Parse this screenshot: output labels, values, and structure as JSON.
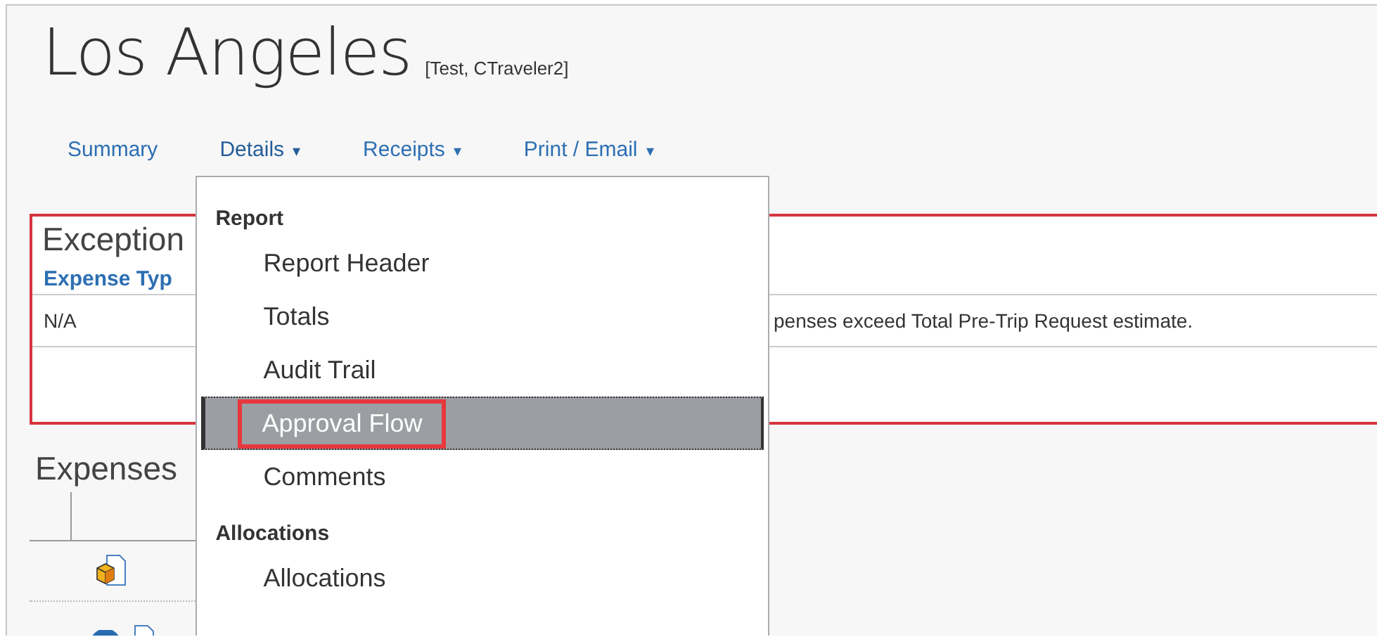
{
  "title": "Los Angeles",
  "subtitle": "[Test, CTraveler2]",
  "tabs": [
    {
      "label": "Summary",
      "expanded": false
    },
    {
      "label": "Details",
      "caret": "▾",
      "expanded": true,
      "menu": [
        {
          "heading": "Report",
          "items": [
            {
              "label": "Report Header",
              "selected": false
            },
            {
              "label": "Totals",
              "selected": false
            },
            {
              "label": "Audit Trail",
              "selected": false
            },
            {
              "label": "Approval Flow",
              "selected": true
            },
            {
              "label": "Comments",
              "selected": false
            }
          ]
        },
        {
          "heading": "Allocations",
          "items": [
            {
              "label": "Allocations",
              "selected": false
            }
          ]
        }
      ]
    },
    {
      "label": "Receipts",
      "caret": "▾",
      "expanded": false
    },
    {
      "label": "Print / Email",
      "caret": "▾",
      "expanded": false
    }
  ],
  "exceptions": {
    "title": "Exception",
    "columns": [
      "Expense Typ"
    ],
    "rows": [
      {
        "cells": [
          "N/A",
          "penses exceed Total Pre-Trip Request estimate."
        ]
      }
    ]
  },
  "expenses": {
    "title": "Expenses"
  }
}
